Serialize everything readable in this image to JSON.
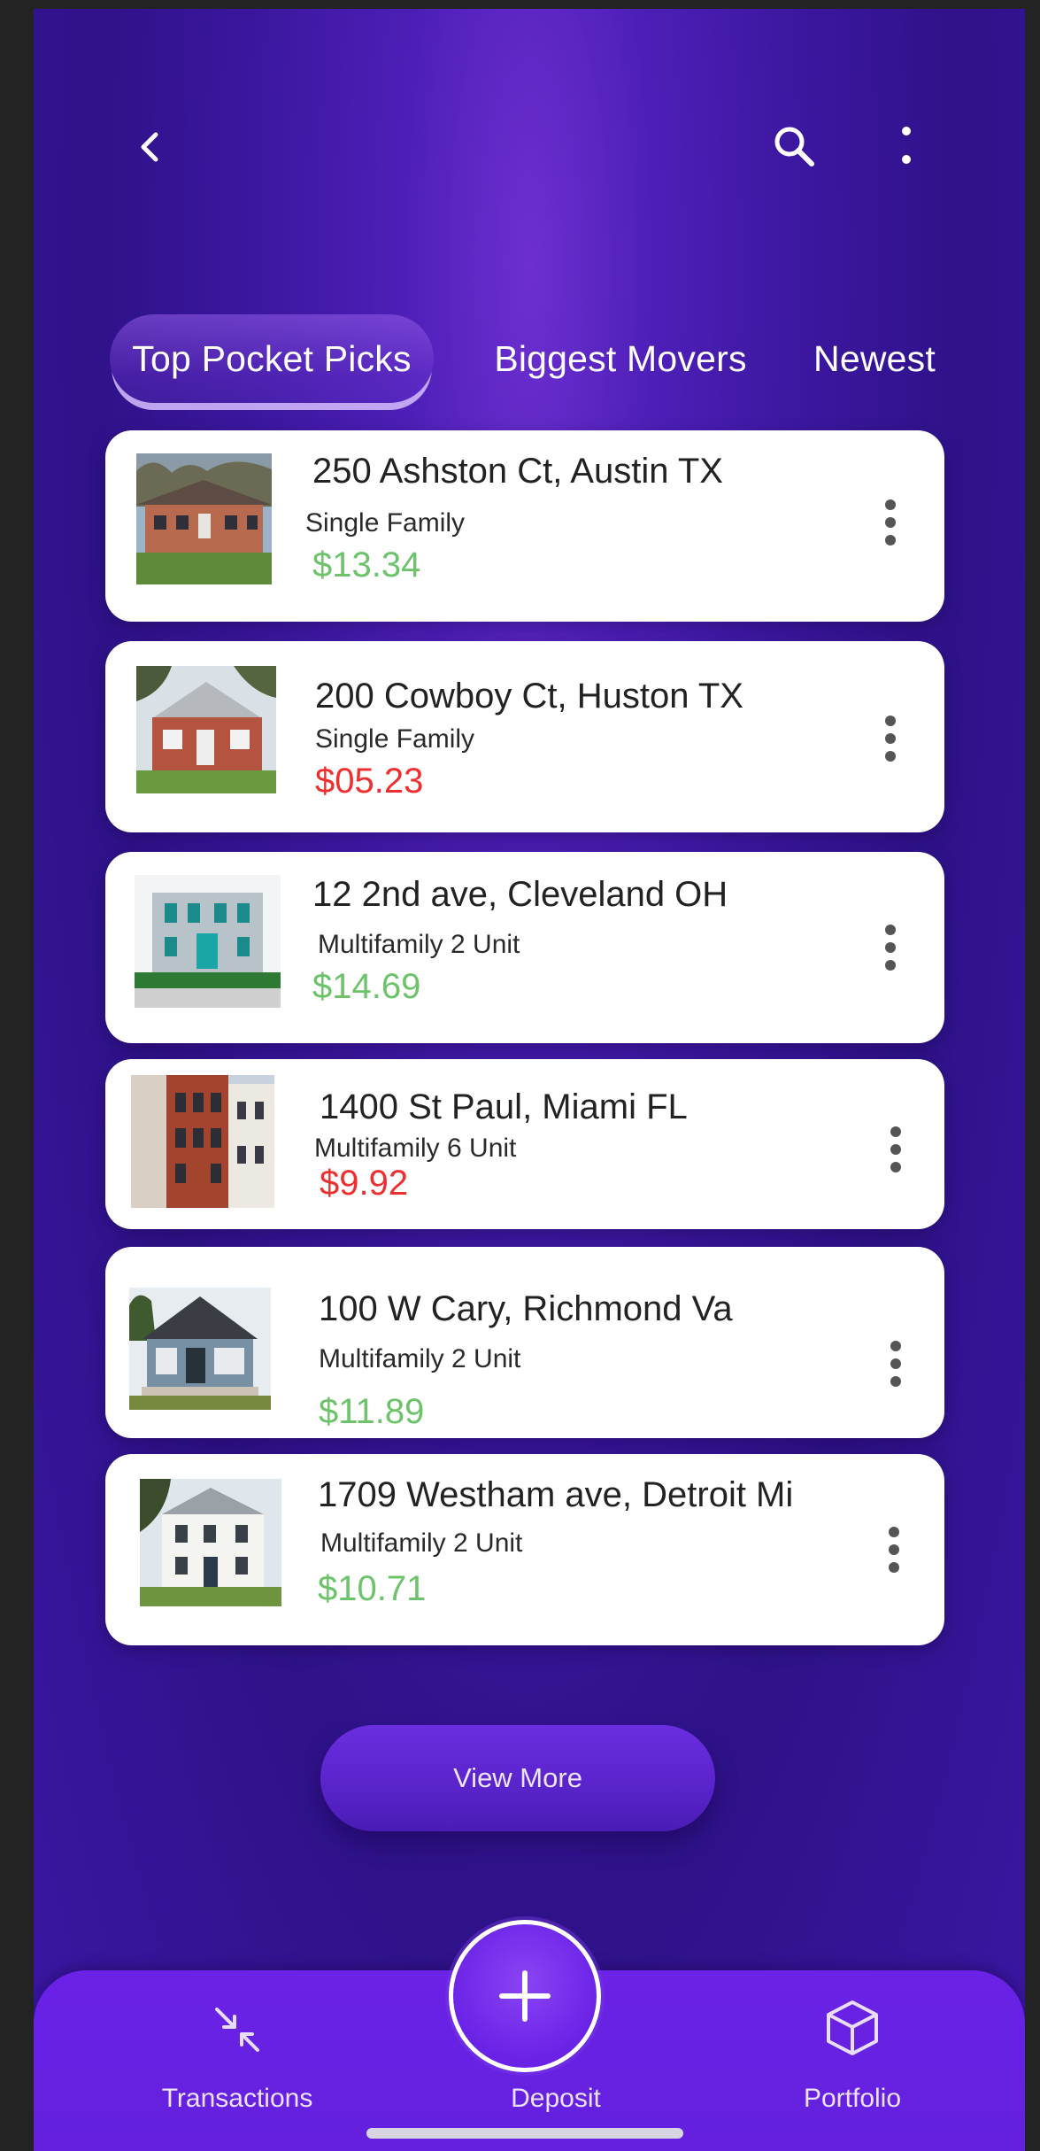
{
  "header": {
    "back_icon": "chevron-left-icon",
    "search_icon": "search-icon",
    "more_icon": "more-vertical-icon"
  },
  "tabs": [
    {
      "label": "Top Pocket Picks",
      "active": true
    },
    {
      "label": "Biggest Movers",
      "active": false
    },
    {
      "label": "Newest",
      "active": false
    }
  ],
  "properties": [
    {
      "address": "250 Ashston Ct, Austin TX",
      "type": "Single Family",
      "price": "$13.34",
      "trend": "up"
    },
    {
      "address": "200 Cowboy Ct, Huston TX",
      "type": "Single Family",
      "price": "$05.23",
      "trend": "down"
    },
    {
      "address": "12 2nd ave, Cleveland OH",
      "type": "Multifamily 2 Unit",
      "price": "$14.69",
      "trend": "up"
    },
    {
      "address": "1400 St Paul, Miami FL",
      "type": "Multifamily 6 Unit",
      "price": "$9.92",
      "trend": "down"
    },
    {
      "address": "100 W Cary, Richmond Va",
      "type": "Multifamily 2 Unit",
      "price": "$11.89",
      "trend": "up"
    },
    {
      "address": "1709 Westham ave, Detroit Mi",
      "type": "Multifamily 2 Unit",
      "price": "$10.71",
      "trend": "up"
    }
  ],
  "view_more_label": "View More",
  "bottom_nav": {
    "transactions_label": "Transactions",
    "deposit_label": "Deposit",
    "portfolio_label": "Portfolio",
    "transactions_icon": "arrows-collapse-icon",
    "deposit_icon": "plus-icon",
    "portfolio_icon": "cube-icon"
  },
  "colors": {
    "background": "#3c17a0",
    "nav": "#6a22e6",
    "price_up": "#6cc36a",
    "price_down": "#ee2f2f"
  }
}
